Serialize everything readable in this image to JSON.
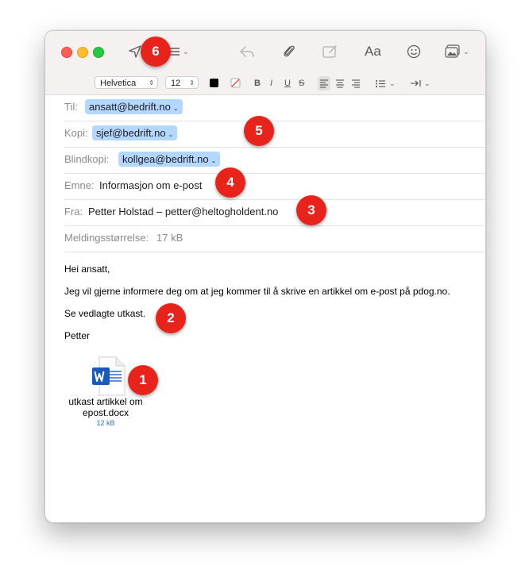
{
  "window": {
    "traffic_lights": [
      "close",
      "minimize",
      "zoom"
    ],
    "colors": {
      "close": "#fe5f57",
      "minimize": "#febc2e",
      "zoom": "#28c840",
      "chip": "#b3d7ff",
      "callout": "#e8231b"
    }
  },
  "toolbar": {
    "icons": [
      "send-icon",
      "header-fields-icon",
      "reply-icon",
      "attachment-icon",
      "markup-icon",
      "fonts-icon",
      "emoji-icon",
      "photo-browser-icon"
    ],
    "fonts_label": "Aa"
  },
  "format_bar": {
    "font_family": "Helvetica",
    "font_size": "12",
    "bold": "B",
    "italic": "I",
    "underline": "U",
    "strikethrough": "S"
  },
  "headers": {
    "to_label": "Til:",
    "to_value": "ansatt@bedrift.no",
    "cc_label": "Kopi:",
    "cc_value": "sjef@bedrift.no",
    "bcc_label": "Blindkopi:",
    "bcc_value": "kollgea@bedrift.no",
    "subject_label": "Emne:",
    "subject_value": "Informasjon om e-post",
    "from_label": "Fra:",
    "from_value": "Petter Holstad – petter@heltogholdent.no",
    "size_label": "Meldingsstørrelse:",
    "size_value": "17 kB"
  },
  "message": {
    "greeting": "Hei ansatt,",
    "line1": "Jeg vil gjerne informere deg om at jeg kommer til å skrive en artikkel om e-post på pdog.no.",
    "line2": "Se vedlagte utkast.",
    "signature": "Petter"
  },
  "attachment": {
    "name_line1": "utkast artikkel om",
    "name_line2": "epost.docx",
    "size": "12 kB",
    "icon": "word-document-icon"
  },
  "callouts": [
    "1",
    "2",
    "3",
    "4",
    "5",
    "6"
  ]
}
